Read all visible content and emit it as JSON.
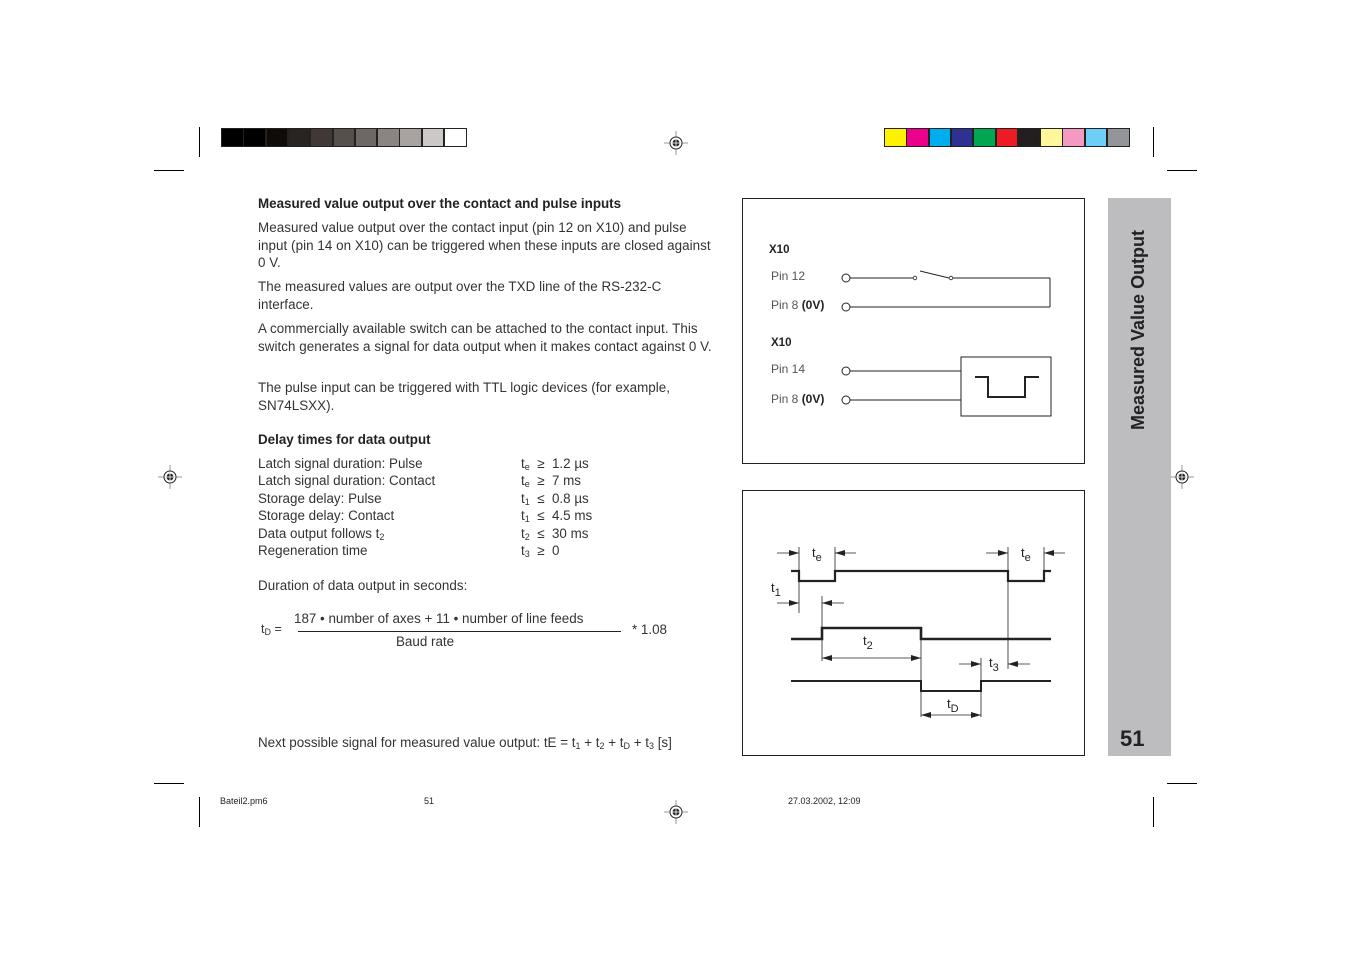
{
  "print_marks": {
    "grayscale_bar": [
      "#000000",
      "#000000",
      "#0f0b08",
      "#2a2421",
      "#403835",
      "#574f4b",
      "#6e6764",
      "#8b8481",
      "#a8a2a0",
      "#cbc8c7",
      "#ffffff"
    ],
    "color_bar": [
      "#fff200",
      "#ec008c",
      "#00aeef",
      "#2e3192",
      "#00a651",
      "#ed1c24",
      "#231f20",
      "#fff799",
      "#f49ac1",
      "#6dcff6",
      "#939598"
    ]
  },
  "section": {
    "heading": "Measured value output over the contact and pulse inputs",
    "paragraphs": [
      "Measured value output over the contact input (pin 12 on X10) and pulse input (pin 14 on X10) can be triggered when these inputs are closed against 0 V.",
      "The measured values are output over the TXD line of the RS-232-C interface.",
      "A commercially available switch can be attached to the contact input. This switch generates a signal for data output when it makes contact against 0 V.",
      "The pulse input can be triggered with TTL logic devices (for example, SN74LSXX)."
    ]
  },
  "delays": {
    "heading": "Delay times for data output",
    "rows": [
      {
        "label": "Latch signal duration: Pulse",
        "sym": "t",
        "sub": "e",
        "op": "≥",
        "value": "1.2 µs"
      },
      {
        "label": "Latch signal duration: Contact",
        "sym": "t",
        "sub": "e",
        "op": "≥",
        "value": "7 ms"
      },
      {
        "label": "Storage delay: Pulse",
        "sym": "t",
        "sub": "1",
        "op": "≤",
        "value": "0.8 µs"
      },
      {
        "label": "Storage delay: Contact",
        "sym": "t",
        "sub": "1",
        "op": "≤",
        "value": "4.5 ms"
      },
      {
        "label_main": "Data output follows t",
        "label_sub": "2",
        "sym": "t",
        "sub": "2",
        "op": "≤",
        "value": "30 ms"
      },
      {
        "label": "Regeneration  time",
        "sym": "t",
        "sub": "3",
        "op": "≥",
        "value": "0"
      }
    ],
    "duration_label": "Duration of data output in seconds:"
  },
  "formula": {
    "lhs_main": "t",
    "lhs_sub": "D",
    "lhs_eq": " =",
    "numerator": "187 •  number of axes + 11 • number of line feeds",
    "denominator": "Baud rate",
    "factor": "* 1.08"
  },
  "next_signal": {
    "text_a": "Next possible signal for measured value output: tE = t",
    "s1": "1",
    "text_b": " + t",
    "s2": "2",
    "text_c": " + t",
    "s3": "D",
    "text_d": " + t",
    "s4": "3",
    "text_e": " [s]"
  },
  "wiring_diagram": {
    "group1": {
      "connector": "X10",
      "pin_a": "Pin 12",
      "pin_b_main": "Pin 8 ",
      "pin_b_bold": "(0V)"
    },
    "group2": {
      "connector": "X10",
      "pin_a": "Pin 14",
      "pin_b_main": "Pin 8 ",
      "pin_b_bold": "(0V)"
    }
  },
  "timing_diagram": {
    "labels": {
      "te": "e",
      "t1": "1",
      "t2": "2",
      "t3": "3",
      "tD": "D",
      "t": "t"
    }
  },
  "side_tab": {
    "title": "Measured Value Output",
    "page_number": "51"
  },
  "footer": {
    "filename": "Bateil2.pm6",
    "page": "51",
    "datetime": "27.03.2002, 12:09"
  }
}
